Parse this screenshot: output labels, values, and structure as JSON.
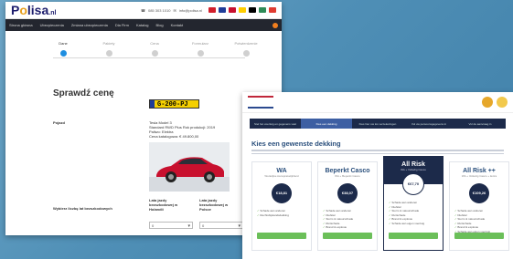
{
  "left": {
    "logo": {
      "prefix": "P",
      "o": "o",
      "rest": "lisa",
      "tld": ".nl"
    },
    "contact": {
      "phone": "085 303 1010",
      "email": "info@polisa.nl"
    },
    "flags": [
      "#d21f2b",
      "#1f3d99",
      "#c8102e",
      "#ffce00",
      "#000000",
      "#2e8b57",
      "#e03c31"
    ],
    "nav": [
      "Strona główna",
      "Ubezpieczenia",
      "Zmiana ubezpieczenia",
      "Dla Firm",
      "Katalog",
      "Blog",
      "Kontakt"
    ],
    "steps": [
      {
        "label": "Dane",
        "active": true
      },
      {
        "label": "Pakiety",
        "active": false
      },
      {
        "label": "Cena",
        "active": false
      },
      {
        "label": "Formularz",
        "active": false
      },
      {
        "label": "Potwierdzenie",
        "active": false
      }
    ],
    "heading": "Sprawdź cenę",
    "plate": "G-200-PJ",
    "vehicle_label": "Pojazd",
    "vehicle_info": [
      "Tesla Model 3",
      "Standard RWD Plus Rok produkcji: 2019",
      "Paliwo: Elektra",
      "Cena katalogowa: € 49.800,00"
    ],
    "claimfree_label": "Wybierz liczbę lat bezszkodowych",
    "nl_label": "Lata jazdy bezszkodowej w Holandii",
    "pl_label": "Lata jazdy bezszkodowej w Polsce",
    "nl_value": "0",
    "pl_value": "0",
    "car_color": "#c8102e"
  },
  "right": {
    "tabs": [
      "Stel het voertuig en gegevens vast",
      "Kies een dekking",
      "Kies hier uw los verzekeringen",
      "Vul uw persoonsgegevens in",
      "Vul de aanvraag in"
    ],
    "active_tab": 1,
    "heading": "Kies een gewenste dekking",
    "cards": [
      {
        "title": "WA",
        "subtitle": "Wettelijke Aansprakelijkheid",
        "price": "€18,81",
        "features": [
          "Schade aan anderen",
          "Rechtsbijstandsdekking"
        ],
        "highlight": false
      },
      {
        "title": "Beperkt Casco",
        "subtitle": "WA + Beperkt Casco",
        "price": "€38,07",
        "features": [
          "Schade aan anderen",
          "Diefstal",
          "Storm & natuurschade",
          "Ruitschade",
          "Brand & explosie"
        ],
        "highlight": false
      },
      {
        "title": "All Risk",
        "subtitle": "WA + Volledig Casco",
        "price": "€67,70",
        "features": [
          "Schade aan anderen",
          "Diefstal",
          "Storm & natuurschade",
          "Ruitschade",
          "Brand & explosie",
          "Schade aan eigen voertuig"
        ],
        "highlight": true
      },
      {
        "title": "All Risk ++",
        "subtitle": "WA + Volledig Casco + Extra",
        "price": "€109,26",
        "features": [
          "Schade aan anderen",
          "Diefstal",
          "Storm & natuurschade",
          "Ruitschade",
          "Brand & explosie",
          "Schade aan eigen voertuig",
          "Extra ongevallendekking"
        ],
        "highlight": false
      }
    ],
    "brand_red": "#c0273a",
    "brand_navy": "#1c2a4a",
    "button_green": "#6bbf59"
  }
}
